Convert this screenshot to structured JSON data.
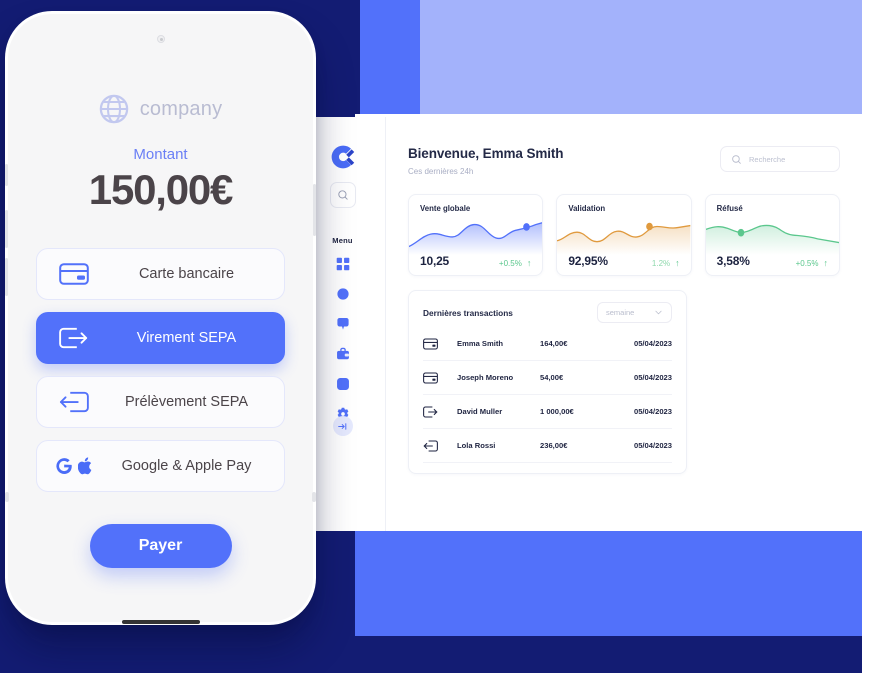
{
  "background": {
    "navy": "#131c73",
    "blue": "#5271fa",
    "lavender": "#a3b2fb"
  },
  "phone": {
    "brand": {
      "name": "company",
      "icon": "globe-icon"
    },
    "amount_label": "Montant",
    "amount_value": "150,00€",
    "methods": [
      {
        "label": "Carte bancaire",
        "icon": "credit-card-icon",
        "selected": false
      },
      {
        "label": "Virement SEPA",
        "icon": "transfer-out-icon",
        "selected": true
      },
      {
        "label": "Prélèvement SEPA",
        "icon": "transfer-in-icon",
        "selected": false
      },
      {
        "label": "Google & Apple Pay",
        "icon": "google-apple-pay-icon",
        "selected": false
      }
    ],
    "pay_button": "Payer",
    "accent": "#5271fa"
  },
  "dashboard": {
    "sidebar": {
      "logo_icon": "brand-c-logo-icon",
      "search_icon": "search-icon",
      "menu_label": "Menu",
      "items": [
        {
          "icon": "grid-dashboard-icon"
        },
        {
          "icon": "circle-icon"
        },
        {
          "icon": "chat-bubble-icon"
        },
        {
          "icon": "briefcase-icon"
        },
        {
          "icon": "rounded-square-icon"
        },
        {
          "icon": "settings-gear-icon"
        }
      ],
      "collapse_icon": "collapse-sidebar-icon"
    },
    "header": {
      "greeting": "Bienvenue, Emma Smith",
      "subtitle": "Ces dernières 24h",
      "search": {
        "placeholder": "Recherche",
        "icon": "search-icon"
      }
    },
    "stats": [
      {
        "title": "Vente globale",
        "value": "10,25",
        "delta": "+0.5%",
        "arrow": "↑",
        "color": "#5271fa",
        "delta_color": "#5bc78d"
      },
      {
        "title": "Validation",
        "value": "92,95%",
        "delta": "1.2%",
        "arrow": "↑",
        "color": "#e09a3e",
        "delta_color": "#8ed8ac"
      },
      {
        "title": "Réfusé",
        "value": "3,58%",
        "delta": "+0.5%",
        "arrow": "↑",
        "color": "#5bc78d",
        "delta_color": "#5bc78d"
      }
    ],
    "transactions": {
      "title": "Dernières transactions",
      "filter": {
        "value": "semaine",
        "icon": "chevron-down-icon"
      },
      "rows": [
        {
          "icon": "credit-card-icon",
          "name": "Emma Smith",
          "amount": "164,00€",
          "date": "05/04/2023"
        },
        {
          "icon": "credit-card-icon",
          "name": "Joseph Moreno",
          "amount": "54,00€",
          "date": "05/04/2023"
        },
        {
          "icon": "transfer-out-icon",
          "name": "David Muller",
          "amount": "1 000,00€",
          "date": "05/04/2023"
        },
        {
          "icon": "transfer-in-icon",
          "name": "Lola Rossi",
          "amount": "236,00€",
          "date": "05/04/2023"
        }
      ]
    }
  },
  "chart_data": [
    {
      "type": "area",
      "title": "Vente globale",
      "x": [
        0,
        1,
        2,
        3,
        4,
        5,
        6,
        7,
        8,
        9,
        10,
        11,
        12
      ],
      "values": [
        22,
        38,
        46,
        44,
        42,
        58,
        68,
        62,
        44,
        36,
        46,
        58,
        62
      ],
      "marker_index": 11,
      "marker_value": 58,
      "color": "#5271fa",
      "ylabel": "",
      "xlabel": "",
      "grid": false,
      "legend": "none"
    },
    {
      "type": "area",
      "title": "Validation",
      "x": [
        0,
        1,
        2,
        3,
        4,
        5,
        6,
        7,
        8,
        9,
        10,
        11,
        12
      ],
      "values": [
        30,
        36,
        52,
        48,
        34,
        38,
        56,
        54,
        44,
        58,
        66,
        62,
        66
      ],
      "marker_index": 9,
      "marker_value": 58,
      "color": "#e09a3e",
      "ylabel": "",
      "xlabel": "",
      "grid": false,
      "legend": "none"
    },
    {
      "type": "area",
      "title": "Réfusé",
      "x": [
        0,
        1,
        2,
        3,
        4,
        5,
        6,
        7,
        8,
        9,
        10,
        11,
        12
      ],
      "values": [
        58,
        62,
        56,
        48,
        54,
        62,
        58,
        50,
        46,
        48,
        46,
        40,
        34
      ],
      "marker_index": 3,
      "marker_value": 54,
      "color": "#5bc78d",
      "ylabel": "",
      "xlabel": "",
      "grid": false,
      "legend": "none"
    }
  ]
}
